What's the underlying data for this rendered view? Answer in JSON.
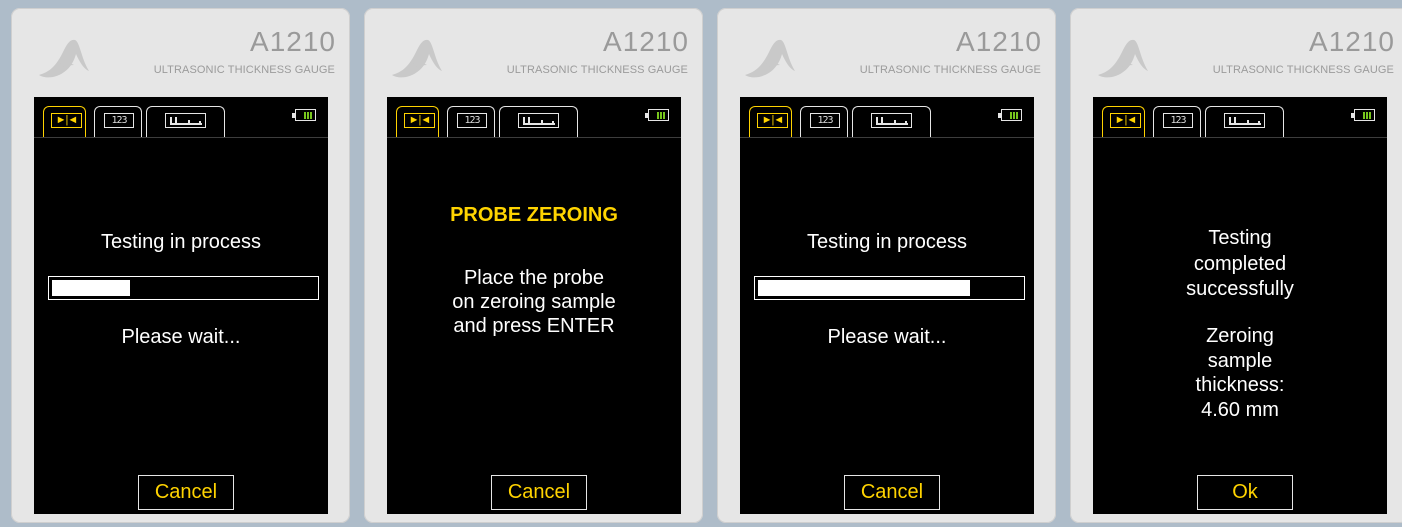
{
  "common": {
    "model": "A1210",
    "subtitle": "ULTRASONIC THICKNESS GAUGE",
    "tabs": [
      "thickness-mode",
      "digits-mode",
      "a-scan-mode"
    ],
    "active_tab": "thickness-mode",
    "battery_icon": "battery-icon",
    "accent_color": "#ffd300",
    "screen_background": "#000000"
  },
  "screens": [
    {
      "status": "Testing in process",
      "progress": {
        "value": 30,
        "label": "30%"
      },
      "wait": "Please wait...",
      "button": "Cancel"
    },
    {
      "title": "PROBE ZEROING",
      "instruction": [
        "Place the probe",
        "on zeroing sample",
        "and press ENTER"
      ],
      "button": "Cancel"
    },
    {
      "status": "Testing in process",
      "progress": {
        "value": 80,
        "label": "80%"
      },
      "wait": "Please wait...",
      "button": "Cancel"
    },
    {
      "complete": [
        "Testing",
        "completed",
        "successfully"
      ],
      "result": [
        "Zeroing",
        "sample",
        "thickness:",
        "4.60 mm"
      ],
      "button": "Ok"
    }
  ]
}
